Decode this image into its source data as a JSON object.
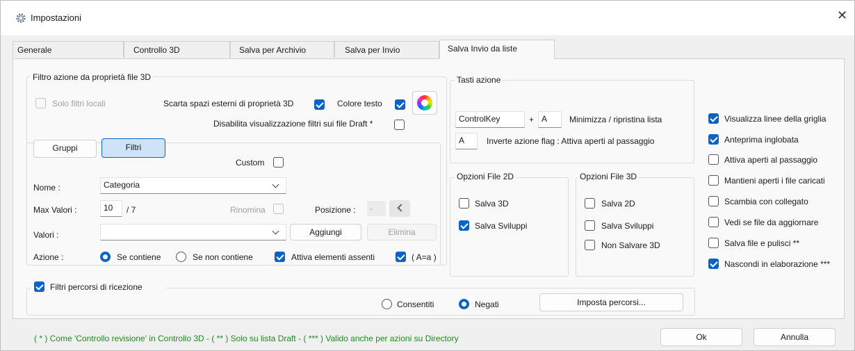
{
  "window": {
    "title": "Impostazioni"
  },
  "tabs": [
    "Generale",
    "Controllo 3D",
    "Salva per Archivio",
    "Salva per Invio",
    "Salva Invio da liste"
  ],
  "filtro": {
    "title": "Filtro azione da proprietà file 3D",
    "solo_filtri_locali": "Solo filtri locali",
    "scarta_spazi": "Scarta spazi esterni di proprietà 3D",
    "colore_testo": "Colore testo",
    "disabilita": "Disabilita visualizzazione filtri sui file Draft *",
    "gruppi": "Gruppi",
    "filtri": "Filtri",
    "custom": "Custom",
    "nome_label": "Nome :",
    "nome_value": "Categoria",
    "max_valori_label": "Max Valori :",
    "max_valori_value": "10",
    "max_valori_total": "/ 7",
    "rinomina": "Rinomina",
    "posizione_label": "Posizione :",
    "posizione_value": "-",
    "valori_label": "Valori :",
    "valori_value": "",
    "aggiungi": "Aggiungi",
    "elimina": "Elimina",
    "azione_label": "Azione :",
    "se_contiene": "Se contiene",
    "se_non_contiene": "Se non contiene",
    "attiva_assenti": "Attiva elementi assenti",
    "aa": "( A=a )"
  },
  "percorsi": {
    "title": "Filtri percorsi di ricezione",
    "consentiti": "Consentiti",
    "negati": "Negati",
    "imposta": "Imposta percorsi..."
  },
  "tasti": {
    "title": "Tasti azione",
    "key1": "ControlKey",
    "plus": "+",
    "key2": "A",
    "desc1": "Minimizza / ripristina lista",
    "key3": "A",
    "desc2": "Inverte azione flag : Attiva aperti al passaggio"
  },
  "opz2d": {
    "title": "Opzioni File 2D",
    "items": [
      "Salva 3D",
      "Salva Sviluppi"
    ]
  },
  "opz3d": {
    "title": "Opzioni File 3D",
    "items": [
      "Salva 2D",
      "Salva Sviluppi",
      "Non Salvare 3D"
    ]
  },
  "right": {
    "items": [
      "Visualizza linee della griglia",
      "Anteprima inglobata",
      "Attiva aperti al passaggio",
      "Mantieni aperti i file caricati",
      "Scambia con collegato",
      "Vedi se file da aggiornare",
      "Salva file e pulisci **",
      "Nascondi in elaborazione ***"
    ]
  },
  "footer": {
    "note": "( * ) Come 'Controllo revisione' in Controllo 3D - ( ** ) Solo su lista Draft - ( *** ) Valido anche per azioni su Directory",
    "ok": "Ok",
    "annulla": "Annulla"
  },
  "colors": {
    "accent": "#0a64c8",
    "note_green": "#1e8c1e"
  }
}
